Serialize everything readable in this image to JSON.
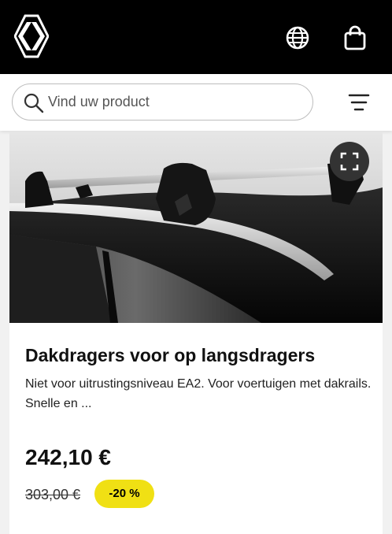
{
  "header": {
    "logo_icon": "renault-logo-icon",
    "language_icon": "globe-icon",
    "cart_icon": "shopping-bag-icon",
    "background": "#000000"
  },
  "search": {
    "placeholder": "Vind uw product",
    "icon": "search-icon",
    "filter_icon": "filter-icon"
  },
  "product": {
    "image_alt": "Dakdragers op langsdragers van een zwarte auto",
    "expand_icon": "fullscreen-icon",
    "title": "Dakdragers voor op langsdragers",
    "description": "Niet voor uitrustingsniveau EA2. Voor voertuigen met dakrails. Snelle en ...",
    "price": "242,10 €",
    "old_price": "303,00 €",
    "discount": "-20 %",
    "discount_color": "#f0e014"
  }
}
